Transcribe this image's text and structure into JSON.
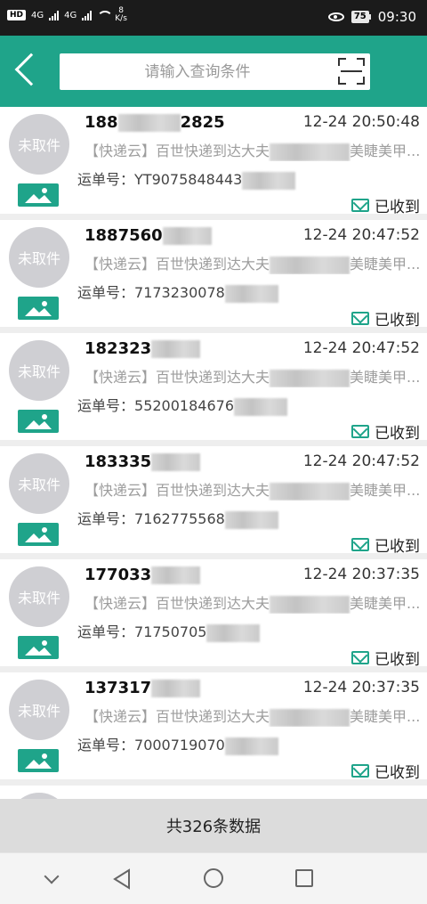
{
  "status_bar": {
    "hd": "HD",
    "sig1": "4G",
    "sig2": "4G",
    "speed_value": "8",
    "speed_unit": "K/s",
    "battery": "75",
    "time": "09:30"
  },
  "search": {
    "placeholder": "请输入查询条件"
  },
  "list": {
    "avatar_label": "未取件",
    "waybill_label": "运单号：",
    "message_prefix": "【快递云】百世快递到达大夫",
    "message_suffix": "美睫美甲...",
    "items": [
      {
        "phone_start": "188",
        "phone_end": "2825",
        "time": "12-24 20:50:48",
        "waybill": "YT9075848443",
        "status": "已收到"
      },
      {
        "phone_start": "1887560",
        "phone_end": "",
        "time": "12-24 20:47:52",
        "waybill": "7173230078",
        "status": "已收到"
      },
      {
        "phone_start": "182323",
        "phone_end": "",
        "time": "12-24 20:47:52",
        "waybill": "55200184676",
        "status": "已收到"
      },
      {
        "phone_start": "183335",
        "phone_end": "",
        "time": "12-24 20:47:52",
        "waybill": "7162775568",
        "status": "已收到"
      },
      {
        "phone_start": "177033",
        "phone_end": "",
        "time": "12-24 20:37:35",
        "waybill": "71750705",
        "status": "已收到"
      },
      {
        "phone_start": "137317",
        "phone_end": "",
        "time": "12-24 20:37:35",
        "waybill": "7000719070",
        "status": "已收到"
      }
    ]
  },
  "footer": {
    "total_text": "共326条数据"
  },
  "colors": {
    "brand": "#1fa48a",
    "avatar_bg": "#cfcfd3"
  },
  "icons": [
    "back-icon",
    "scan-icon",
    "photo-icon",
    "mail-received-icon",
    "nav-down-icon",
    "nav-back-icon",
    "nav-home-icon",
    "nav-recent-icon"
  ]
}
